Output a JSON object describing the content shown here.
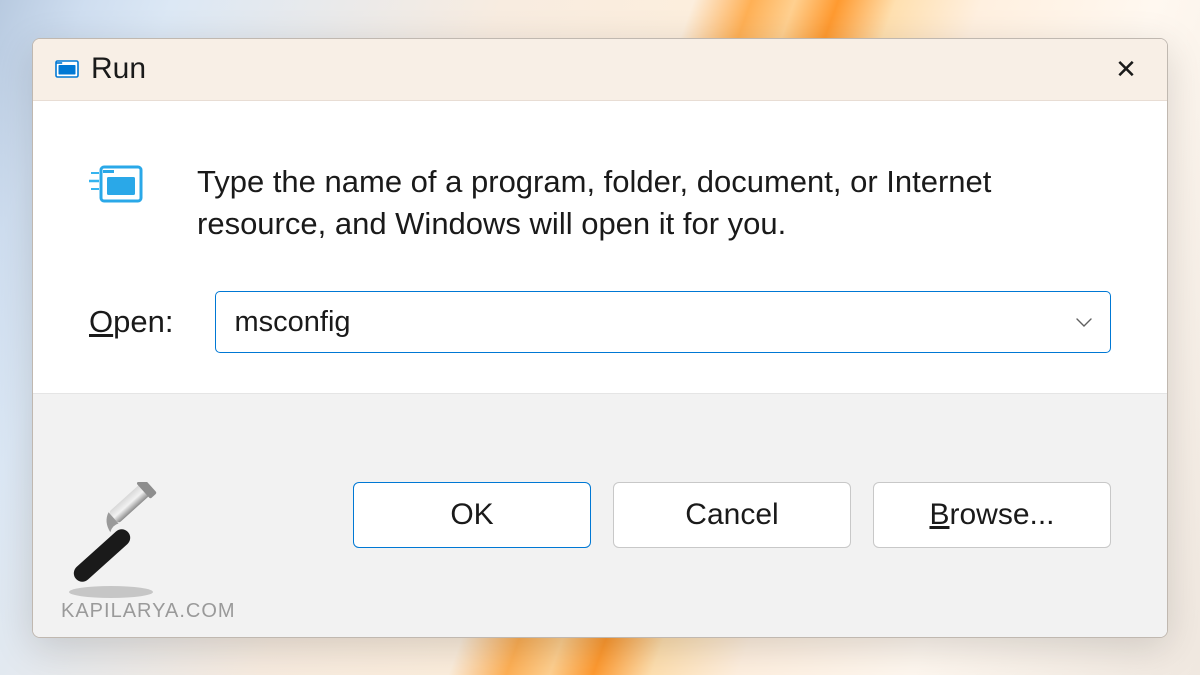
{
  "titlebar": {
    "title": "Run",
    "close_glyph": "✕"
  },
  "description": "Type the name of a program, folder, document, or Internet resource, and Windows will open it for you.",
  "open_label_pre": "O",
  "open_label_post": "pen:",
  "input_value": "msconfig",
  "buttons": {
    "ok": "OK",
    "cancel": "Cancel",
    "browse_pre": "B",
    "browse_post": "rowse..."
  },
  "watermark": "KAPILARYA.COM"
}
